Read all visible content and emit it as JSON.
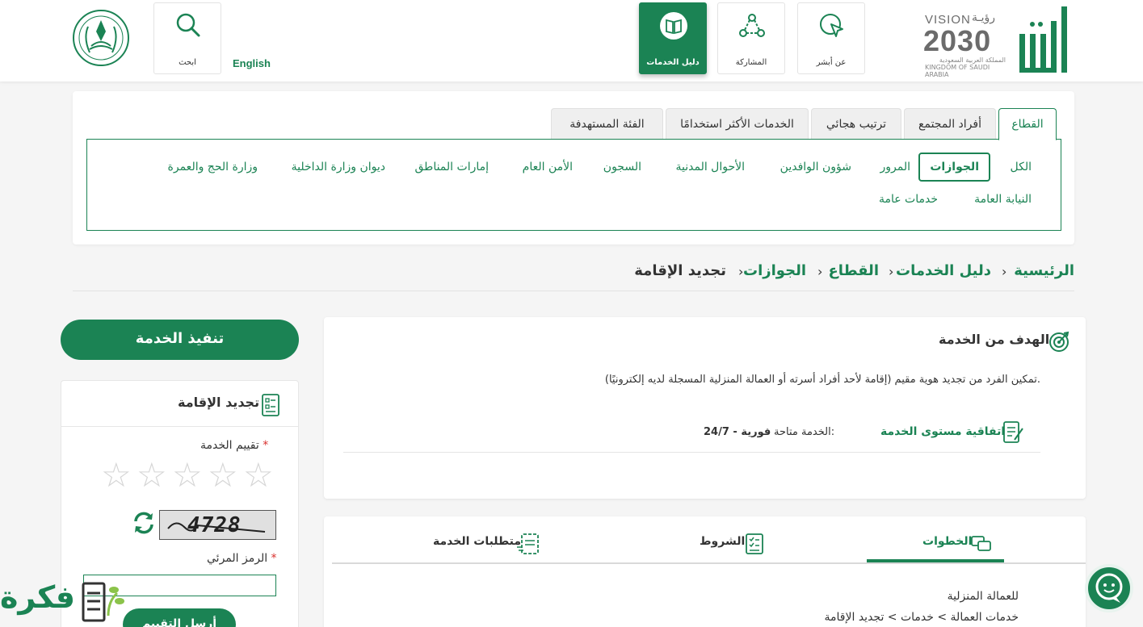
{
  "header": {
    "vision": {
      "word": "VISION",
      "ar": "رؤيـة",
      "year": "2030",
      "sub_ar": "المملكة العربية السعودية",
      "sub_en": "KINGDOM OF SAUDI ARABIA"
    },
    "nav": [
      {
        "label": "عن أبشر",
        "icon": "cursor-click-icon"
      },
      {
        "label": "المشاركة",
        "icon": "share-nodes-icon"
      },
      {
        "label": "دليل الخدمات",
        "icon": "book-icon",
        "active": true
      }
    ],
    "search_label": "ابحث",
    "english_label": "English"
  },
  "filters": {
    "tabs": [
      "القطاع",
      "أفراد المجتمع",
      "ترتيب هجائي",
      "الخدمات الأكثر استخدامًا",
      "الفئة المستهدفة"
    ],
    "categories_row1": [
      "الكل",
      "الجوازات",
      "المرور",
      "شؤون الوافدين",
      "الأحوال المدنية",
      "السجون",
      "الأمن العام",
      "إمارات المناطق",
      "ديوان وزارة الداخلية",
      "وزارة الحج والعمرة"
    ],
    "categories_row2": [
      "النيابة العامة",
      "خدمات عامة"
    ],
    "active_category": "الجوازات"
  },
  "breadcrumb": [
    "الرئيسية",
    "دليل الخدمات",
    "القطاع",
    "الجوازات",
    "تجديد الإقامة"
  ],
  "goal": {
    "title": "الهدف من الخدمة",
    "description": "تمكين الفرد من تجديد هوية مقيم (إقامة لأحد أفراد أسرته أو العمالة المنزلية المسجلة لديه إلكترونيًا).",
    "sla_link": "اتفاقية مستوى الخدمة",
    "availability_label": "الخدمة متاحة:",
    "availability_value": "فورية - 24/7"
  },
  "detail_tabs": {
    "steps": "الخطوات",
    "terms": "الشروط",
    "requirements": "متطلبات الخدمة",
    "steps_lines": [
      "للعمالة المنزلية",
      "خدمات العمالة > خدمات > تجديد الإقامة"
    ]
  },
  "sidebar": {
    "execute_button": "تنفيذ الخدمة",
    "service_title": "تجديد الإقامة",
    "rating_label": "تقييم الخدمة",
    "required_mark": "*",
    "rating_value": 0,
    "rating_max": 5,
    "captcha_text": "4728",
    "code_label": "الرمز المرئي",
    "code_value": "",
    "send_button": "أرسل التقييم"
  },
  "watermark": "فكرة",
  "colors": {
    "primary": "#1b8354",
    "required": "#d9312e",
    "star_empty": "#d6d6d6"
  }
}
